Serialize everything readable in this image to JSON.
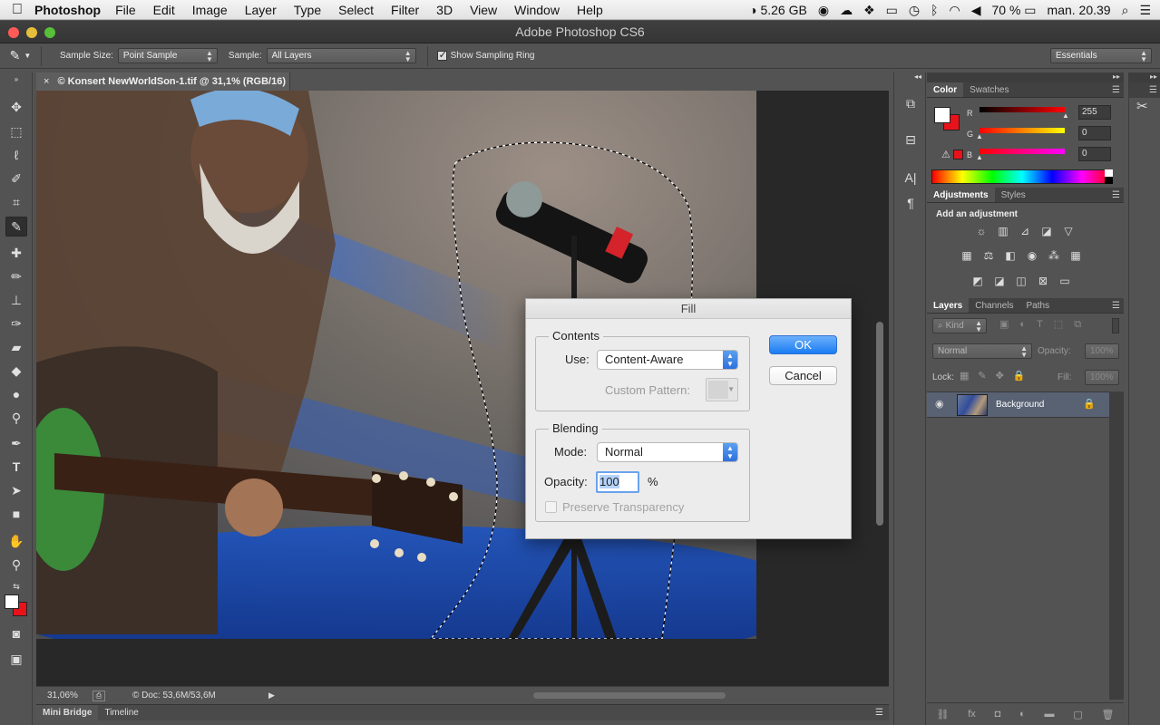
{
  "menubar": {
    "app": "Photoshop",
    "items": [
      "File",
      "Edit",
      "Image",
      "Layer",
      "Type",
      "Select",
      "Filter",
      "3D",
      "View",
      "Window",
      "Help"
    ],
    "memory": "5.26 GB",
    "battery": "70 %",
    "clock": "man. 20.39"
  },
  "window": {
    "title": "Adobe Photoshop CS6"
  },
  "options": {
    "sample_size_label": "Sample Size:",
    "sample_size_value": "Point Sample",
    "sample_label": "Sample:",
    "sample_value": "All Layers",
    "show_ring_label": "Show Sampling Ring",
    "workspace": "Essentials"
  },
  "document": {
    "tab_title": "© Konsert NewWorldSon-1.tif @ 31,1% (RGB/16)",
    "zoom": "31,06%",
    "doc_info": "© Doc: 53,6M/53,6M"
  },
  "bottom_tabs": [
    "Mini Bridge",
    "Timeline"
  ],
  "dialog": {
    "title": "Fill",
    "contents_label": "Contents",
    "use_label": "Use:",
    "use_value": "Content-Aware",
    "custom_pattern_label": "Custom Pattern:",
    "blending_label": "Blending",
    "mode_label": "Mode:",
    "mode_value": "Normal",
    "opacity_label": "Opacity:",
    "opacity_value": "100",
    "opacity_unit": "%",
    "preserve_label": "Preserve Transparency",
    "ok_label": "OK",
    "cancel_label": "Cancel"
  },
  "color_panel": {
    "tabs": [
      "Color",
      "Swatches"
    ],
    "r_label": "R",
    "g_label": "G",
    "b_label": "B",
    "r_value": "255",
    "g_value": "0",
    "b_value": "0"
  },
  "adjust_panel": {
    "tabs": [
      "Adjustments",
      "Styles"
    ],
    "heading": "Add an adjustment"
  },
  "layers_panel": {
    "tabs": [
      "Layers",
      "Channels",
      "Paths"
    ],
    "kind": "Kind",
    "blend_mode": "Normal",
    "opacity_label": "Opacity:",
    "opacity_value": "100%",
    "lock_label": "Lock:",
    "fill_label": "Fill:",
    "fill_value": "100%",
    "layer_name": "Background"
  },
  "colors": {
    "foreground": "#ffffff",
    "background": "#e8121a",
    "accent": "#3d86f0"
  }
}
